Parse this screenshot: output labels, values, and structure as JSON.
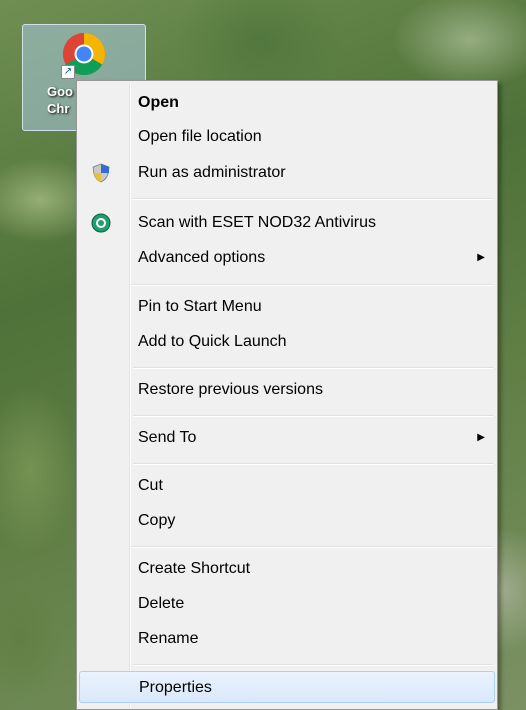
{
  "desktop": {
    "shortcut": {
      "label_line1": "Goo",
      "label_line2": "Chr",
      "icon": "chrome-icon"
    }
  },
  "context_menu": {
    "items": [
      {
        "label": "Open",
        "bold": true
      },
      {
        "label": "Open file location"
      },
      {
        "label": "Run as administrator",
        "icon": "uac-shield-icon"
      },
      {
        "label": "Scan with ESET NOD32 Antivirus",
        "icon": "eset-icon"
      },
      {
        "label": "Advanced options",
        "submenu": true
      },
      {
        "label": "Pin to Start Menu"
      },
      {
        "label": "Add to Quick Launch"
      },
      {
        "label": "Restore previous versions"
      },
      {
        "label": "Send To",
        "submenu": true
      },
      {
        "label": "Cut"
      },
      {
        "label": "Copy"
      },
      {
        "label": "Create Shortcut"
      },
      {
        "label": "Delete"
      },
      {
        "label": "Rename"
      },
      {
        "label": "Properties",
        "highlighted": true
      }
    ],
    "submenu_arrow": "▶"
  },
  "colors": {
    "menu_bg": "#f0f0f0",
    "highlight": "#d9e8fb",
    "highlight_border": "#aecff7"
  }
}
